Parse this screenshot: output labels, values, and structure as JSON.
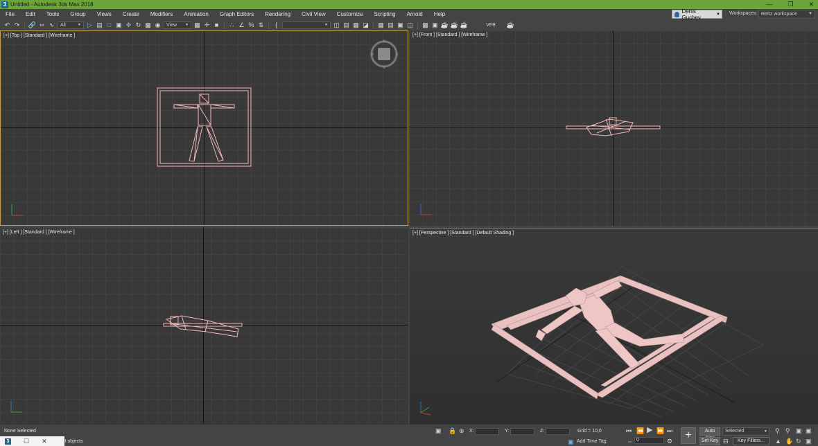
{
  "window": {
    "title": "Untitled - Autodesk 3ds Max 2018",
    "app_icon": "3",
    "controls": [
      "minimize-icon",
      "restore-icon",
      "close-icon"
    ]
  },
  "menu": {
    "items": [
      "File",
      "Edit",
      "Tools",
      "Group",
      "Views",
      "Create",
      "Modifiers",
      "Animation",
      "Graph Editors",
      "Rendering",
      "Civil View",
      "Customize",
      "Scripting",
      "Arnold",
      "Help"
    ],
    "user": "Denis Guchev",
    "workspaces_label": "Workspaces:",
    "workspace": "Rettz workspace"
  },
  "toolbar": {
    "selection_filter": "All",
    "reference_coord": "View",
    "named_selection": "",
    "vfb_label": "VFB"
  },
  "viewports": {
    "top": {
      "label": "[+] [Top ] [Standard ] [Wireframe ]"
    },
    "front": {
      "label": "[+] [Front ] [Standard ] [Wireframe ]"
    },
    "left": {
      "label": "[+] [Left ] [Standard ] [Wireframe ]"
    },
    "perspective": {
      "label": "[+] [Perspective ] [Standard ] [Default Shading ]"
    }
  },
  "viewcube": {
    "faces": {
      "n": "N",
      "w": "W",
      "e": "E",
      "s": "S"
    }
  },
  "status": {
    "selection": "None Selected",
    "prompt_tail": "ct objects",
    "x_label": "X:",
    "y_label": "Y:",
    "z_label": "Z:",
    "x_value": "",
    "y_value": "",
    "z_value": "",
    "grid": "Grid = 10,0",
    "add_time_tag": "Add Time Tag",
    "auto_key": "Auto Key",
    "set_key": "Set Key",
    "selected_dropdown": "Selected",
    "key_filters": "Key Filters...",
    "frame": "0"
  },
  "colors": {
    "title_bar": "#6aa43a",
    "viewport_bg": "#393939",
    "active_viewport_border": "#c7a04a",
    "wireframe": "#f2b8b8",
    "shaded_object": "#f0c8c8"
  }
}
